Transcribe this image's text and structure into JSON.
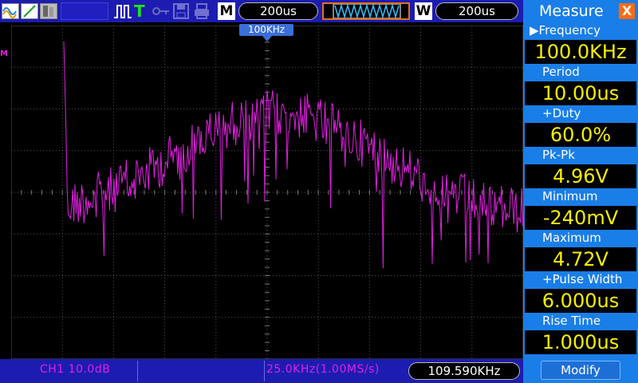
{
  "toolbar": {
    "timebase": "200us",
    "mode_m": "M",
    "mode_w": "W",
    "window_timebase": "200us",
    "trigger_t": "T"
  },
  "screen": {
    "trigger_label": "100KHz",
    "channel_marker": "M"
  },
  "status": {
    "channel": "CH1 10.0dB",
    "span": "25.0KHz(1.00MS/s)",
    "counter": "109.590KHz"
  },
  "measure": {
    "title": "Measure",
    "close": "X",
    "items": [
      {
        "label": "▶Frequency",
        "value": "100.0KHz"
      },
      {
        "label": "Period",
        "value": "10.00us"
      },
      {
        "label": "+Duty",
        "value": "60.0%"
      },
      {
        "label": "Pk-Pk",
        "value": "4.96V"
      },
      {
        "label": "Minimum",
        "value": "-240mV"
      },
      {
        "label": "Maximum",
        "value": "4.72V"
      },
      {
        "label": "+Pulse Width",
        "value": "6.000us"
      },
      {
        "label": "Rise Time",
        "value": "1.000us"
      }
    ],
    "modify": "Modify"
  },
  "colors": {
    "trace": "#e020e0",
    "panel": "#1a7ee8",
    "value_text": "#f8f000",
    "toolbar": "#1c1cb0"
  }
}
